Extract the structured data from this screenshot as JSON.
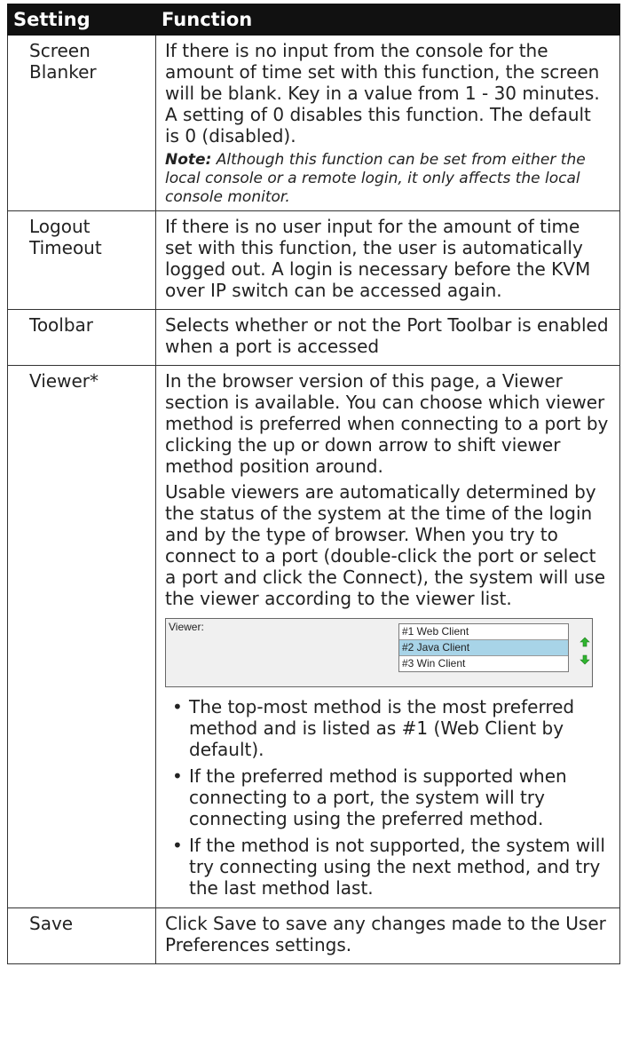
{
  "table": {
    "headers": {
      "setting": "Setting",
      "function": "Function"
    },
    "screen_blanker": {
      "setting": "Screen Blanker",
      "text": "If there is no input from the console for the amount of time set with this function, the screen will be blank. Key in a value from 1 - 30 minutes. A setting of 0 disables this function. The default is 0 (disabled).",
      "note_label": "Note:",
      "note_text": " Although this function can be set from either the local console or a remote login, it only affects the local console monitor."
    },
    "logout_timeout": {
      "setting": "Logout Timeout",
      "text": "If there is no user input for the amount of time set with this function, the user is automatically logged out. A login is necessary before the KVM over IP switch can be accessed again."
    },
    "toolbar": {
      "setting": "Toolbar",
      "text": "Selects whether or not the Port Toolbar is enabled when a port is accessed"
    },
    "viewer": {
      "setting": "Viewer*",
      "text1": "In the browser version of this page, a Viewer section is available. You can choose which viewer method is preferred when connecting to a port by clicking the up or down arrow to shift viewer method position around.",
      "text2": "Usable viewers are automatically determined by the status of the system at the time of the login and by the type of browser. When you try to connect to a port (double-click the port or select a port and click the Connect), the system will use the viewer according to the viewer list.",
      "screenshot": {
        "label": "Viewer:",
        "items": [
          "#1 Web Client",
          "#2 Java Client",
          "#3 Win Client"
        ],
        "selected_index": 1,
        "up_arrow_icon": "green-up-arrow-icon",
        "down_arrow_icon": "green-down-arrow-icon"
      },
      "bullets": [
        "The top-most method is the most preferred method and is listed as #1 (Web Client by default).",
        "If the preferred method is supported when connecting to a port, the system will try connecting using the preferred method.",
        "If the method is not supported, the system will try connecting using the next method, and try the last method last."
      ],
      "bullet_char": "•"
    },
    "save": {
      "setting": "Save",
      "text": "Click Save to save any changes made to the User Preferences settings."
    }
  }
}
